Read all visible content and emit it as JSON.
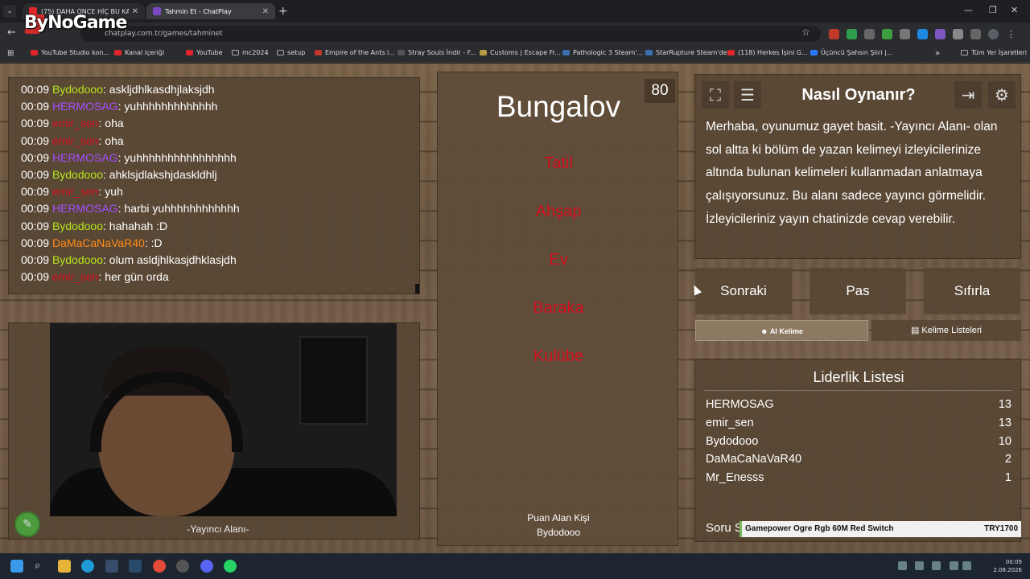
{
  "browser": {
    "tabs": [
      {
        "label": "(75) DAHA ÖNCE HİÇ BU KADAR",
        "favicon_color": "#e0262b"
      },
      {
        "label": "Tahmin Et - ChatPlay",
        "favicon_color": "#7a49c4"
      }
    ],
    "url": "chatplay.com.tr/games/tahminet",
    "overlay_logo": "ByNoGame",
    "bookmarks": [
      {
        "label": "YouTube Studio kon...",
        "color": "#e0262b"
      },
      {
        "label": "Kanal içeriği",
        "color": "#e0262b"
      },
      {
        "label": "YouTube",
        "color": "#e0262b"
      },
      {
        "label": "mc2024",
        "color": "#aaaaaa"
      },
      {
        "label": "setup",
        "color": "#aaaaaa"
      },
      {
        "label": "Empire of the Ants i...",
        "color": "#c0392b"
      },
      {
        "label": "Stray Souls İndir - F...",
        "color": "#555555"
      },
      {
        "label": "Customs | Escape Fr...",
        "color": "#b59b41"
      },
      {
        "label": "Pathologic 3 Steam'...",
        "color": "#3a6fb0"
      },
      {
        "label": "StarRupture Steam'de",
        "color": "#3a6fb0"
      },
      {
        "label": "(118) Herkes İşini G...",
        "color": "#e0262b"
      },
      {
        "label": "Üçüncü Şahsın Şiiri |...",
        "color": "#2979ff"
      }
    ],
    "all_bookmarks": "Tüm Yer İşaretleri"
  },
  "chat": {
    "messages": [
      {
        "time": "00:09",
        "user": "Bydodooo",
        "color": "#b5e61d",
        "text": ": askljdhlkasdhjlaksjdh"
      },
      {
        "time": "00:09",
        "user": "HERMOSAG",
        "color": "#a64dff",
        "text": ": yuhhhhhhhhhhhhh"
      },
      {
        "time": "00:09",
        "user": "emir_sen",
        "color": "#d10f1d",
        "text": ": oha"
      },
      {
        "time": "00:09",
        "user": "emir_sen",
        "color": "#d10f1d",
        "text": ": oha"
      },
      {
        "time": "00:09",
        "user": "HERMOSAG",
        "color": "#a64dff",
        "text": ": yuhhhhhhhhhhhhhhhh"
      },
      {
        "time": "00:09",
        "user": "Bydodooo",
        "color": "#b5e61d",
        "text": ": ahklsjdlakshjdaskldhlj"
      },
      {
        "time": "00:09",
        "user": "emir_sen",
        "color": "#d10f1d",
        "text": ": yuh"
      },
      {
        "time": "00:09",
        "user": "HERMOSAG",
        "color": "#a64dff",
        "text": ": harbi yuhhhhhhhhhhhh"
      },
      {
        "time": "00:09",
        "user": "Bydodooo",
        "color": "#b5e61d",
        "text": ": hahahah :D"
      },
      {
        "time": "00:09",
        "user": "DaMaCaNaVaR40",
        "color": "#ff8c1a",
        "text": ": :D"
      },
      {
        "time": "00:09",
        "user": "Bydodooo",
        "color": "#b5e61d",
        "text": ": olum asldjhlkasjdhklasjdh"
      },
      {
        "time": "00:09",
        "user": "emir_sen",
        "color": "#d10f1d",
        "text": ": her gün orda"
      }
    ]
  },
  "camera": {
    "caption": "-Yayıncı Alanı-"
  },
  "word": {
    "main": "Bungalov",
    "timer": "80",
    "forbidden": [
      "Tatil",
      "Ahşap",
      "Ev",
      "Baraka",
      "Kulübe"
    ],
    "winner_label": "Puan Alan Kişi",
    "winner_name": "Bydodooo"
  },
  "help": {
    "title": "Nasıl Oynanır?",
    "text": "Merhaba, oyunumuz gayet basit. -Yayıncı Alanı- olan sol altta ki bölüm de yazan kelimeyi izleyicilerinize altında bulunan kelimeleri kullanmadan anlatmaya çalışıyorsunuz. Bu alanı sadece yayıncı görmelidir. İzleyicileriniz yayın chatinizde cevap verebilir."
  },
  "controls": {
    "next": "Sonraki",
    "pass": "Pas",
    "reset": "Sıfırla",
    "ai_word": "AI Kelime",
    "word_lists": "Kelime Listeleri"
  },
  "leaderboard": {
    "title": "Liderlik Listesi",
    "rows": [
      {
        "name": "HERMOSAG",
        "score": "13"
      },
      {
        "name": "emir_sen",
        "score": "13"
      },
      {
        "name": "Bydodooo",
        "score": "10"
      },
      {
        "name": "DaMaCaNaVaR40",
        "score": "2"
      },
      {
        "name": "Mr_Enesss",
        "score": "1"
      }
    ],
    "question_label": "Soru S"
  },
  "ticker": {
    "text": "Gamepower Ogre Rgb 60M Red Switch",
    "price": "TRY1700"
  },
  "taskbar": {
    "time": "00:09",
    "date": "2.08.2026"
  }
}
